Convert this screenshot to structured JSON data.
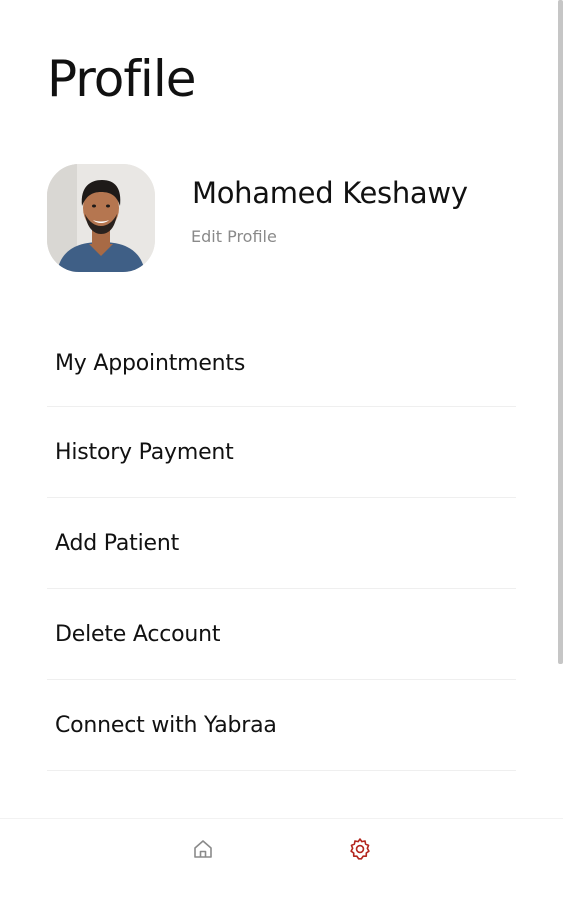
{
  "page": {
    "title": "Profile"
  },
  "profile": {
    "name": "Mohamed Keshawy",
    "edit_label": "Edit Profile"
  },
  "menu": {
    "items": [
      {
        "label": "My Appointments"
      },
      {
        "label": "History Payment"
      },
      {
        "label": "Add Patient"
      },
      {
        "label": "Delete Account"
      },
      {
        "label": "Connect with Yabraa"
      }
    ]
  },
  "bottom_nav": {
    "items": [
      {
        "icon": "home-icon",
        "active": false,
        "color": "#8a8a8a"
      },
      {
        "icon": "gear-icon",
        "active": true,
        "color": "#b3261e"
      }
    ]
  }
}
